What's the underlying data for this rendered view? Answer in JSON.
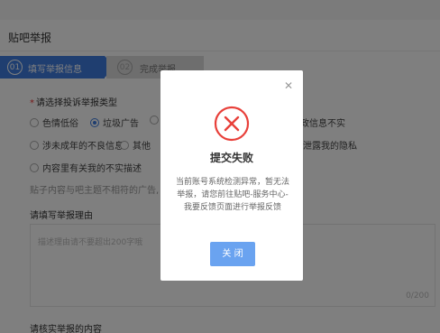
{
  "page": {
    "title": "贴吧举报",
    "steps": [
      {
        "num": "01",
        "label": "填写举报信息"
      },
      {
        "num": "02",
        "label": "完成举报"
      }
    ],
    "type_section": {
      "label": "请选择投诉举报类型",
      "options": [
        {
          "label": "色情低俗",
          "checked": false
        },
        {
          "label": "垃圾广告",
          "checked": true
        },
        {
          "label": "有政信息不实",
          "checked": false
        },
        {
          "label": "涉未成年的不良信息",
          "checked": false
        },
        {
          "label": "其他",
          "checked": false
        },
        {
          "label": "泄露我的隐私",
          "checked": false
        },
        {
          "label": "内容里有关我的不实描述",
          "checked": false
        }
      ],
      "hint": "贴子内容与吧主题不相符的广告,"
    },
    "reason_section": {
      "label": "请填写举报理由",
      "placeholder": "描述理由请不要超出200字哦",
      "counter": "0/200"
    },
    "verify_section": {
      "label": "请核实举报的内容"
    }
  },
  "modal": {
    "title": "提交失败",
    "message": "当前账号系统检测异常，暂无法举报，请您前往贴吧-服务中心-我要反馈页面进行举报反馈",
    "button": "关 闭",
    "close_icon": "close-icon",
    "status_icon": "error-x-icon",
    "accent_color": "#e8403a",
    "button_color": "#6aa3f0"
  },
  "colors": {
    "primary": "#3f7de0",
    "overlay": "rgba(0,0,0,0.5)"
  }
}
